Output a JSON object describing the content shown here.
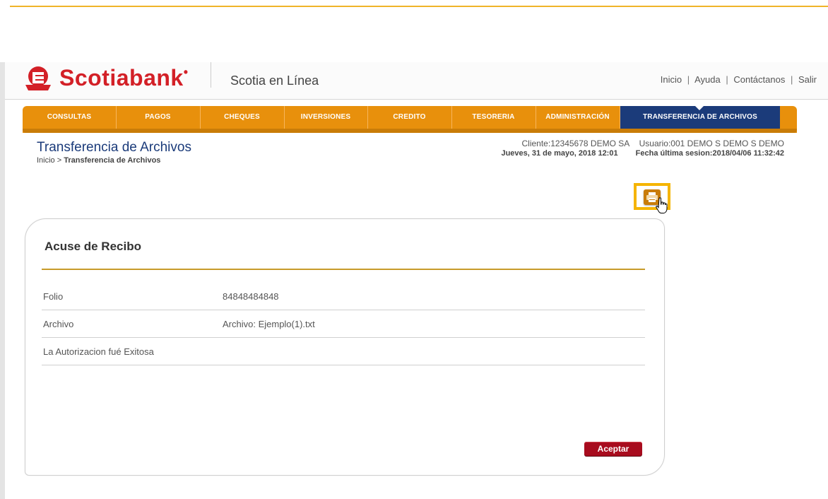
{
  "brand": {
    "logo_text": "Scotiabank",
    "product_name": "Scotia en Línea",
    "colors": {
      "red": "#d32027",
      "orange": "#e8900c",
      "navy": "#1b3b7a",
      "gold": "#c79b2a"
    }
  },
  "top_links": {
    "inicio": "Inicio",
    "ayuda": "Ayuda",
    "contactanos": "Contáctanos",
    "salir": "Salir",
    "separator": "|"
  },
  "nav": {
    "items": [
      {
        "label": "CONSULTAS"
      },
      {
        "label": "PAGOS"
      },
      {
        "label": "CHEQUES"
      },
      {
        "label": "INVERSIONES"
      },
      {
        "label": "CREDITO"
      },
      {
        "label": "TESORERIA"
      },
      {
        "label": "ADMINISTRACIÓN"
      },
      {
        "label": "TRANSFERENCIA DE ARCHIVOS",
        "active": true
      }
    ]
  },
  "page": {
    "title": "Transferencia de Archivos",
    "breadcrumb_home": "Inicio",
    "breadcrumb_sep": ">",
    "breadcrumb_current": "Transferencia de Archivos"
  },
  "session": {
    "client": "Cliente:12345678  DEMO SA",
    "user": "Usuario:001 DEMO S DEMO S DEMO",
    "date": "Jueves, 31 de mayo, 2018 12:01",
    "last_session": "Fecha última sesion:2018/04/06 11:32:42"
  },
  "toolbar": {
    "print_icon": "printer-icon",
    "cursor_icon": "hand-pointer-icon"
  },
  "receipt": {
    "title": "Acuse de Recibo",
    "rows": [
      {
        "label": "Folio",
        "value": "84848484848"
      },
      {
        "label": "Archivo",
        "value": "Archivo: Ejemplo(1).txt"
      },
      {
        "label": "La Autorizacion fué Exitosa",
        "value": ""
      }
    ],
    "accept_label": "Aceptar"
  }
}
